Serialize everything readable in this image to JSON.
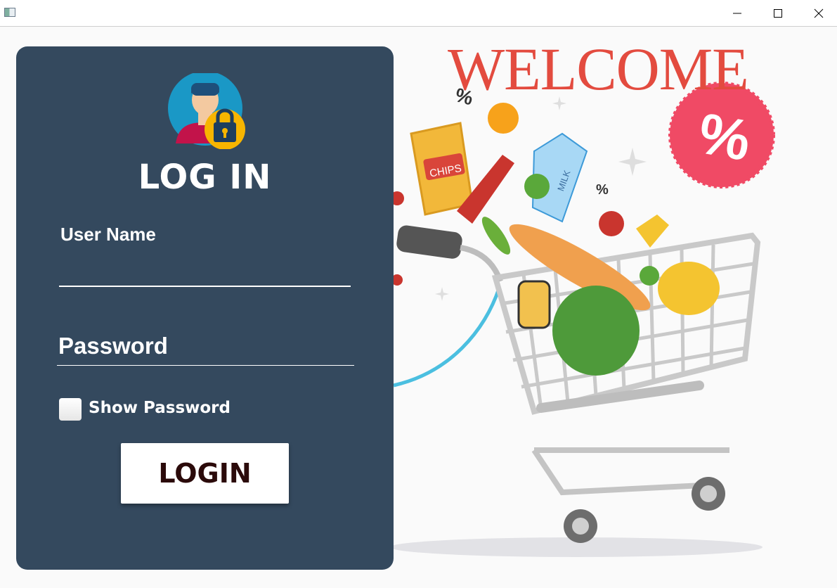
{
  "window": {
    "controls": [
      "minimize-icon",
      "maximize-icon",
      "close-icon"
    ]
  },
  "login": {
    "title": "LOG IN",
    "username_label": "User Name",
    "username_value": "",
    "password_placeholder": "Password",
    "show_password_label": "Show Password",
    "show_password_checked": false,
    "login_button": "LOGIN"
  },
  "banner": {
    "welcome": "WELCOME",
    "discount_symbol": "%",
    "chips_label": "CHIPS",
    "milk_label": "MILK"
  },
  "colors": {
    "panel": "#34495e",
    "welcome": "#e34b3f",
    "badge": "#f04a65",
    "button_text": "#2b0a0a"
  }
}
